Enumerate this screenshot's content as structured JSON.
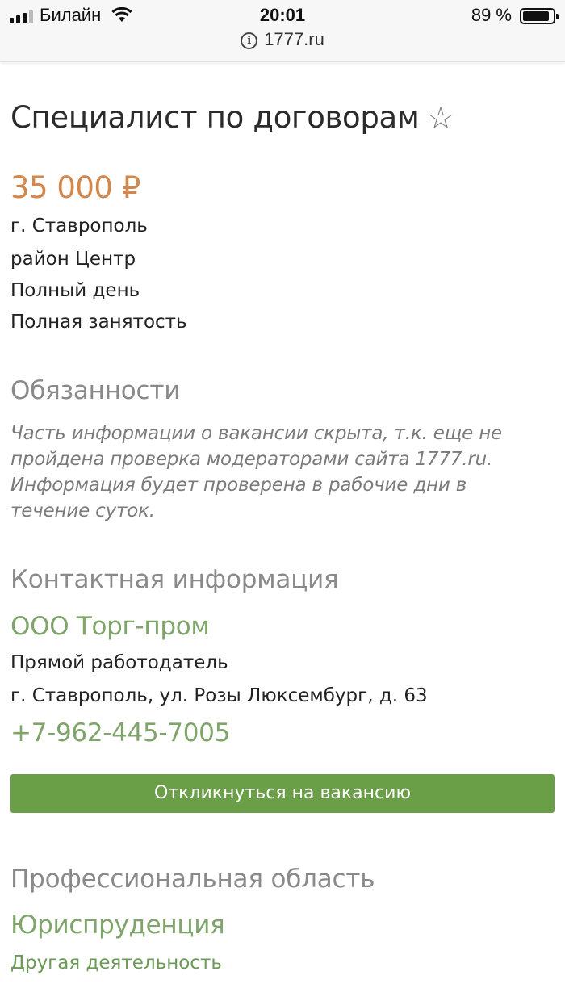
{
  "status_bar": {
    "carrier": "Билайн",
    "time": "20:01",
    "battery_percent": "89 %",
    "battery_level": 0.89
  },
  "browser": {
    "url": "1777.ru"
  },
  "vacancy": {
    "title": "Специалист по договорам",
    "salary": "35 000 ₽",
    "city": "г. Ставрополь",
    "district": "район Центр",
    "schedule": "Полный день",
    "employment": "Полная занятость"
  },
  "duties": {
    "heading": "Обязанности",
    "notice": "Часть информации о вакансии скрыта, т.к. еще не пройдена проверка модераторами сайта 1777.ru. Информация будет проверена в рабочие дни в течение суток."
  },
  "contacts": {
    "heading": "Контактная информация",
    "company": "ООО Торг-пром",
    "employer_type": "Прямой работодатель",
    "address": "г. Ставрополь, ул. Розы Люксембург, д. 63",
    "phone": "+7-962-445-7005"
  },
  "actions": {
    "apply_label": "Откликнуться на вакансию"
  },
  "professional_area": {
    "heading": "Профессиональная область",
    "area": "Юриспруденция",
    "subarea": "Другая деятельность"
  },
  "colors": {
    "accent_green": "#6a9f47",
    "link_green": "#7fa56a",
    "salary_orange": "#d4874a"
  }
}
